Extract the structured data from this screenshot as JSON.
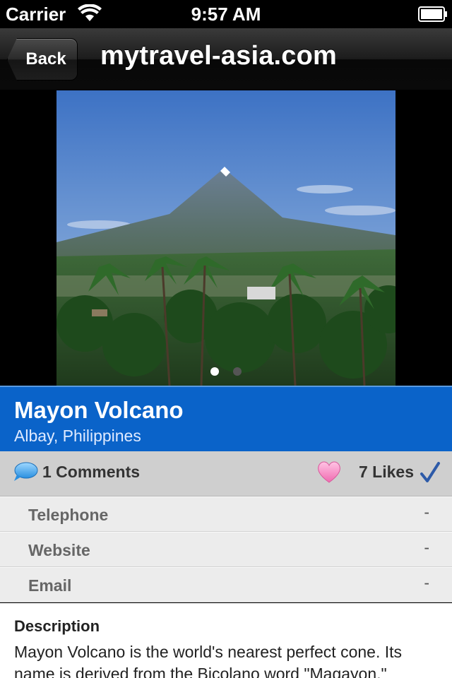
{
  "status_bar": {
    "carrier": "Carrier",
    "time": "9:57 AM"
  },
  "nav": {
    "back_label": "Back",
    "title": "mytravel-asia.com"
  },
  "gallery": {
    "pages": 2,
    "current_page": 1
  },
  "place": {
    "name": "Mayon Volcano",
    "location": "Albay, Philippines"
  },
  "social": {
    "comments_label": "1 Comments",
    "likes_label": "7 Likes"
  },
  "info": {
    "rows": [
      {
        "label": "Telephone",
        "value": "-"
      },
      {
        "label": "Website",
        "value": "-"
      },
      {
        "label": "Email",
        "value": "-"
      }
    ]
  },
  "description": {
    "heading": "Description",
    "text": "Mayon Volcano is the world's nearest perfect cone. Its name is derived from the Bicolano word \"Magayon,\""
  },
  "colors": {
    "title_band": "#0a63c9",
    "nav_bar": "#1c1c1c",
    "info_row": "#ececec"
  },
  "icons": [
    "wifi-icon",
    "battery-icon",
    "comment-bubble-icon",
    "heart-icon",
    "check-icon"
  ]
}
